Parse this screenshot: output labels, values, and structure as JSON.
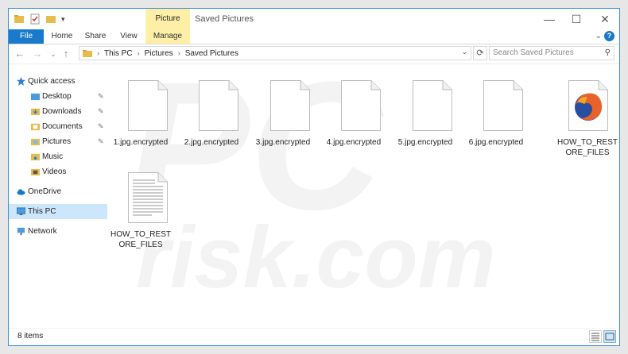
{
  "window": {
    "title": "Saved Pictures",
    "contextual_tab": "Picture Tools",
    "controls": {
      "minimize": "—",
      "maximize": "☐",
      "close": "✕"
    }
  },
  "ribbon": {
    "tabs": [
      "File",
      "Home",
      "Share",
      "View",
      "Manage"
    ],
    "help": "?"
  },
  "address": {
    "path": [
      "This PC",
      "Pictures",
      "Saved Pictures"
    ],
    "search_placeholder": "Search Saved Pictures"
  },
  "nav": {
    "items": [
      {
        "label": "Quick access",
        "icon": "star-icon",
        "pinned": false
      },
      {
        "label": "Desktop",
        "icon": "desktop-folder-icon",
        "pinned": true
      },
      {
        "label": "Downloads",
        "icon": "downloads-folder-icon",
        "pinned": true
      },
      {
        "label": "Documents",
        "icon": "documents-folder-icon",
        "pinned": true
      },
      {
        "label": "Pictures",
        "icon": "pictures-folder-icon",
        "pinned": true
      },
      {
        "label": "Music",
        "icon": "music-folder-icon",
        "pinned": false
      },
      {
        "label": "Videos",
        "icon": "videos-folder-icon",
        "pinned": false
      },
      {
        "label": "OneDrive",
        "icon": "onedrive-cloud-icon",
        "pinned": false
      },
      {
        "label": "This PC",
        "icon": "computer-icon",
        "pinned": false,
        "selected": true
      },
      {
        "label": "Network",
        "icon": "network-icon",
        "pinned": false
      }
    ]
  },
  "files": [
    {
      "name": "1.jpg.encrypted",
      "icon": "blank-file-icon"
    },
    {
      "name": "2.jpg.encrypted",
      "icon": "blank-file-icon"
    },
    {
      "name": "3.jpg.encrypted",
      "icon": "blank-file-icon"
    },
    {
      "name": "4.jpg.encrypted",
      "icon": "blank-file-icon"
    },
    {
      "name": "5.jpg.encrypted",
      "icon": "blank-file-icon"
    },
    {
      "name": "6.jpg.encrypted",
      "icon": "blank-file-icon"
    },
    {
      "name": "HOW_TO_RESTORE_FILES",
      "icon": "firefox-html-file-icon"
    },
    {
      "name": "HOW_TO_RESTORE_FILES",
      "icon": "text-file-icon"
    }
  ],
  "status": {
    "item_count": "8 items"
  },
  "colors": {
    "accent": "#1979ca",
    "selection": "#cce6fb",
    "contextual_tab": "#fdf0a6",
    "border": "#3c8fd6"
  }
}
